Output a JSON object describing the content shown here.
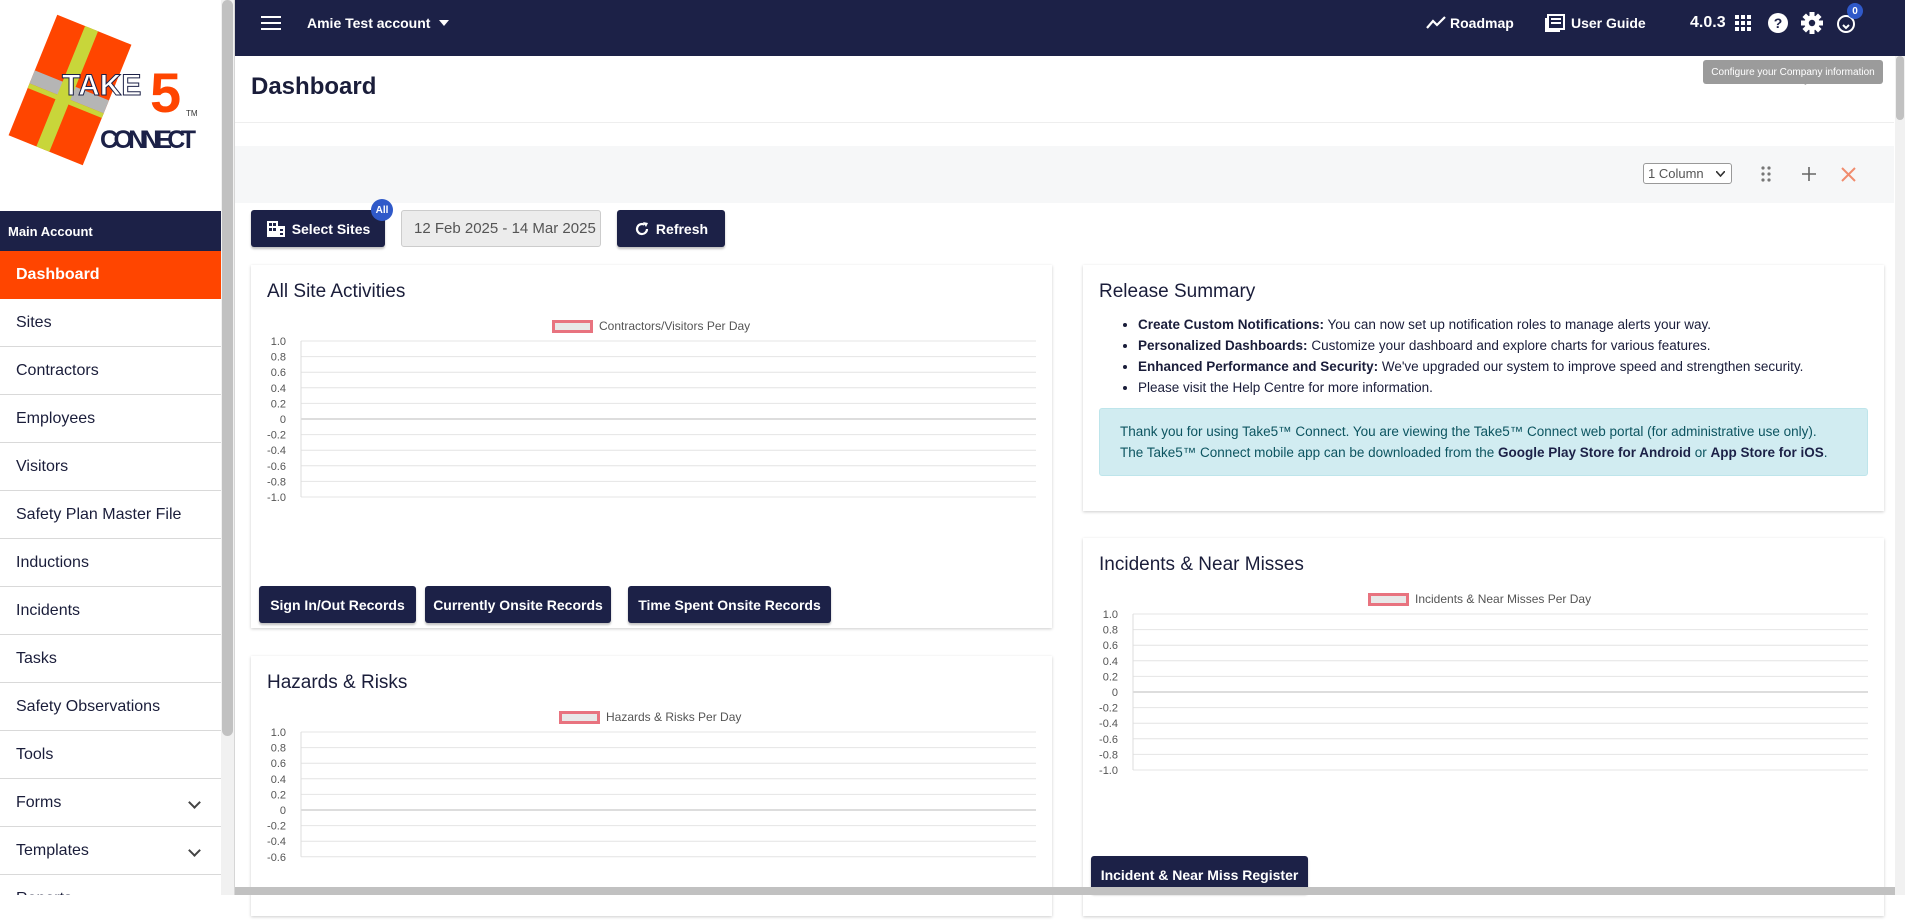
{
  "logo": {
    "text_top": "TAKE",
    "text_five": "5",
    "text_bottom": "CONNECT",
    "tm": "TM"
  },
  "sidebar": {
    "section": "Main Account",
    "items": [
      {
        "label": "Dashboard",
        "active": true
      },
      {
        "label": "Sites"
      },
      {
        "label": "Contractors"
      },
      {
        "label": "Employees"
      },
      {
        "label": "Visitors"
      },
      {
        "label": "Safety Plan Master File"
      },
      {
        "label": "Inductions"
      },
      {
        "label": "Incidents"
      },
      {
        "label": "Tasks"
      },
      {
        "label": "Safety Observations"
      },
      {
        "label": "Tools"
      },
      {
        "label": "Forms",
        "expandable": true
      },
      {
        "label": "Templates",
        "expandable": true
      },
      {
        "label": "Reports"
      }
    ]
  },
  "topbar": {
    "account": "Amie Test account",
    "roadmap": "Roadmap",
    "user_guide": "User Guide",
    "version": "4.0.3",
    "notification_count": "0",
    "tooltip": "Configure your Company information"
  },
  "page": {
    "title": "Dashboard"
  },
  "toolbar": {
    "column_select": "1 Column"
  },
  "filters": {
    "select_sites": "Select Sites",
    "sites_badge": "All",
    "date_range": "12 Feb 2025 - 14 Mar 2025",
    "refresh": "Refresh"
  },
  "cards": {
    "activities": {
      "title": "All Site Activities",
      "legend": "Contractors/Visitors Per Day",
      "buttons": [
        "Sign In/Out Records",
        "Currently Onsite Records",
        "Time Spent Onsite Records"
      ]
    },
    "hazards": {
      "title": "Hazards & Risks",
      "legend": "Hazards & Risks Per Day"
    },
    "release": {
      "title": "Release Summary",
      "items": [
        {
          "bold": "Create Custom Notifications:",
          "text": " You can now set up notification roles to manage alerts your way."
        },
        {
          "bold": "Personalized Dashboards:",
          "text": " Customize your dashboard and explore charts for various features."
        },
        {
          "bold": "Enhanced Performance and Security:",
          "text": " We've upgraded our system to improve speed and strengthen security."
        },
        {
          "bold": "",
          "text": "Please visit the Help Centre for more information."
        }
      ],
      "info_line1": "Thank you for using Take5™ Connect. You are viewing the Take5™ Connect web portal (for administrative use only).",
      "info_line2_pre": "The Take5™ Connect mobile app can be downloaded from the ",
      "info_android": "Google Play Store for Android",
      "info_or": " or ",
      "info_ios": "App Store for iOS",
      "info_end": "."
    },
    "incidents": {
      "title": "Incidents & Near Misses",
      "legend": "Incidents & Near Misses Per Day",
      "button": "Incident & Near Miss Register"
    }
  },
  "chart_data": [
    {
      "type": "line",
      "title": "",
      "series": [
        {
          "name": "Contractors/Visitors Per Day",
          "values": []
        }
      ],
      "ylim": [
        -1.0,
        1.0
      ],
      "yticks": [
        "1.0",
        "0.8",
        "0.6",
        "0.4",
        "0.2",
        "0",
        "-0.2",
        "-0.4",
        "-0.6",
        "-0.8",
        "-1.0"
      ],
      "legend": "top"
    },
    {
      "type": "line",
      "title": "",
      "series": [
        {
          "name": "Hazards & Risks Per Day",
          "values": []
        }
      ],
      "ylim": [
        -1.0,
        1.0
      ],
      "yticks": [
        "1.0",
        "0.8",
        "0.6",
        "0.4",
        "0.2",
        "0",
        "-0.2",
        "-0.4",
        "-0.6"
      ],
      "legend": "top"
    },
    {
      "type": "line",
      "title": "",
      "series": [
        {
          "name": "Incidents & Near Misses Per Day",
          "values": []
        }
      ],
      "ylim": [
        -1.0,
        1.0
      ],
      "yticks": [
        "1.0",
        "0.8",
        "0.6",
        "0.4",
        "0.2",
        "0",
        "-0.2",
        "-0.4",
        "-0.6",
        "-0.8",
        "-1.0"
      ],
      "legend": "top"
    }
  ]
}
